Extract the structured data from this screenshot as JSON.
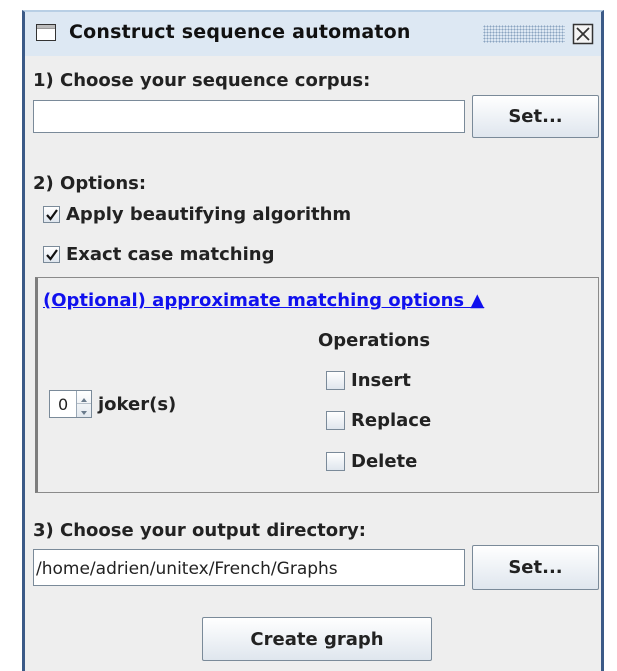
{
  "window": {
    "title": "Construct sequence automaton"
  },
  "step1": {
    "label": "1) Choose your sequence corpus:",
    "corpus_value": "",
    "set_label": "Set..."
  },
  "step2": {
    "label": "2) Options:",
    "beautify": {
      "label": "Apply beautifying algorithm",
      "checked": true
    },
    "exact_case": {
      "label": "Exact case matching",
      "checked": true
    }
  },
  "approx": {
    "link_label": "(Optional) approximate matching options ▲",
    "operations_label": "Operations",
    "joker_value": "0",
    "joker_label": "joker(s)",
    "insert": {
      "label": "Insert",
      "checked": false
    },
    "replace": {
      "label": "Replace",
      "checked": false
    },
    "delete": {
      "label": "Delete",
      "checked": false
    }
  },
  "step3": {
    "label": "3) Choose your output directory:",
    "directory_value": "/home/adrien/unitex/French/Graphs",
    "set_label": "Set..."
  },
  "create_label": "Create graph",
  "icons": {
    "window": "window-icon",
    "close": "close-icon",
    "check": "check-icon"
  },
  "colors": {
    "link": "#1010ee",
    "titlebar": "#dde8f3",
    "frame": "#3b5a87"
  }
}
